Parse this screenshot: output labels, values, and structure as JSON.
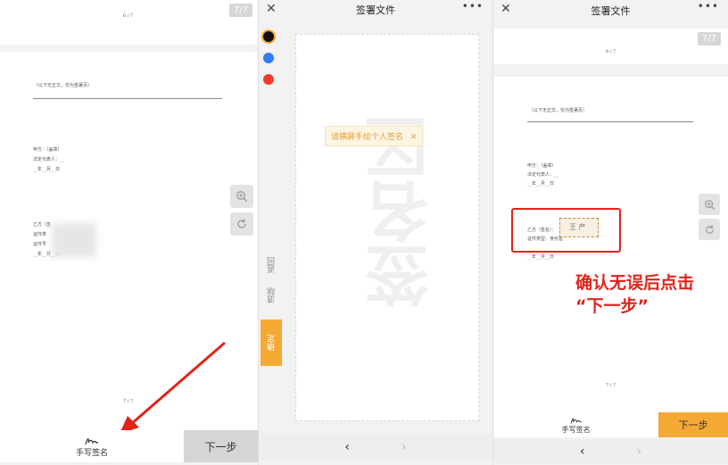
{
  "panel1": {
    "page_counter": "7/7",
    "page_indicator_top": "6 / 7",
    "note_line": "（以下无正文，仅为签署页）",
    "party_a": [
      "甲方：（盖章）",
      "法定代表人：__",
      "__年__月__日"
    ],
    "party_b": [
      "乙方（签",
      "证件类",
      "证件号",
      "__年__月__日"
    ],
    "page_indicator_bottom": "7 / 7",
    "bottom": {
      "handwrite_label": "手写签名",
      "next_label": "下一步"
    }
  },
  "panel2": {
    "title": "签署文件",
    "close": "✕",
    "more": "•••",
    "colors": [
      "#111111",
      "#2f7cf6",
      "#f23b2e"
    ],
    "hint": "请横屏手绘个人签名",
    "hint_close": "✕",
    "watermark": "签名区",
    "return_label": "返回",
    "clear_label": "清除",
    "confirm_label": "确定",
    "nav_prev": "‹",
    "nav_next": "›"
  },
  "panel3": {
    "title": "签署文件",
    "close": "✕",
    "more": "•••",
    "page_counter": "7/7",
    "page_indicator_top": "6 / 7",
    "note_line": "（以下无正文，仅为签署页）",
    "party_a": [
      "甲方：（盖章）",
      "法定代表人：__",
      "__年__月__日"
    ],
    "party_b": [
      "乙方（签名）：",
      "证件类型：身份证",
      "__年__月__日"
    ],
    "signature_text": "王 产",
    "annotation": [
      "确认无误后点击",
      "“下一步”"
    ],
    "page_indicator_bottom": "7 / 7",
    "bottom": {
      "handwrite_label": "手写签名",
      "next_label": "下一步"
    },
    "nav_prev": "‹",
    "nav_next": "›"
  },
  "colors": {
    "accent": "#f5a935",
    "annotation": "#e2231a"
  }
}
